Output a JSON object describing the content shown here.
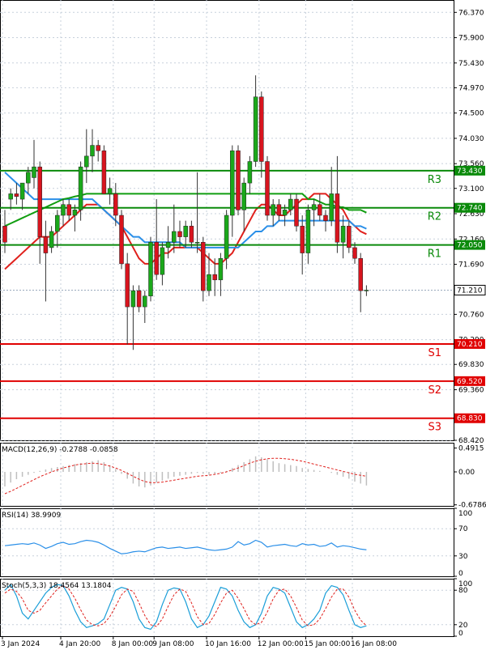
{
  "chart_data": [
    {
      "type": "candlestick",
      "panel": "main",
      "title": "",
      "xlabel": "",
      "ylabel": "",
      "ylim": [
        68.42,
        76.6
      ],
      "y_ticks": [
        "76.370",
        "75.900",
        "75.430",
        "74.970",
        "74.500",
        "74.030",
        "73.560",
        "73.100",
        "72.630",
        "72.160",
        "71.690",
        "70.760",
        "70.290",
        "69.830",
        "69.360",
        "68.420"
      ],
      "x_tick_labels": [
        "3 Jan 2024",
        "4 Jan 20:00",
        "8 Jan 00:00",
        "9 Jan 08:00",
        "10 Jan 16:00",
        "12 Jan 00:00",
        "15 Jan 00:00",
        "16 Jan 08:00"
      ],
      "candles": [
        {
          "o": 72.4,
          "h": 72.7,
          "l": 71.9,
          "c": 72.1
        },
        {
          "o": 72.9,
          "h": 73.1,
          "l": 72.7,
          "c": 73.0
        },
        {
          "o": 73.0,
          "h": 73.2,
          "l": 72.8,
          "c": 72.95
        },
        {
          "o": 72.9,
          "h": 73.2,
          "l": 72.7,
          "c": 73.2
        },
        {
          "o": 73.2,
          "h": 73.5,
          "l": 73.0,
          "c": 73.4
        },
        {
          "o": 73.3,
          "h": 74.0,
          "l": 73.1,
          "c": 73.5
        },
        {
          "o": 73.5,
          "h": 73.6,
          "l": 71.7,
          "c": 72.2
        },
        {
          "o": 72.2,
          "h": 72.5,
          "l": 71.0,
          "c": 71.9
        },
        {
          "o": 72.0,
          "h": 72.4,
          "l": 71.9,
          "c": 72.3
        },
        {
          "o": 72.3,
          "h": 72.7,
          "l": 72.0,
          "c": 72.6
        },
        {
          "o": 72.6,
          "h": 72.9,
          "l": 72.4,
          "c": 72.8
        },
        {
          "o": 72.8,
          "h": 72.9,
          "l": 72.5,
          "c": 72.6
        },
        {
          "o": 72.6,
          "h": 72.8,
          "l": 72.3,
          "c": 72.7
        },
        {
          "o": 72.7,
          "h": 73.6,
          "l": 72.5,
          "c": 73.5
        },
        {
          "o": 73.5,
          "h": 74.2,
          "l": 73.2,
          "c": 73.7
        },
        {
          "o": 73.7,
          "h": 74.2,
          "l": 73.4,
          "c": 73.9
        },
        {
          "o": 73.9,
          "h": 74.0,
          "l": 73.6,
          "c": 73.8
        },
        {
          "o": 73.8,
          "h": 73.9,
          "l": 73.0,
          "c": 73.0
        },
        {
          "o": 73.0,
          "h": 73.3,
          "l": 72.8,
          "c": 73.1
        },
        {
          "o": 73.0,
          "h": 73.2,
          "l": 72.4,
          "c": 72.6
        },
        {
          "o": 72.6,
          "h": 72.7,
          "l": 71.6,
          "c": 71.7
        },
        {
          "o": 71.7,
          "h": 71.9,
          "l": 70.2,
          "c": 70.9
        },
        {
          "o": 70.9,
          "h": 71.3,
          "l": 70.1,
          "c": 71.2
        },
        {
          "o": 71.2,
          "h": 71.3,
          "l": 70.8,
          "c": 70.9
        },
        {
          "o": 70.9,
          "h": 71.2,
          "l": 70.6,
          "c": 71.1
        },
        {
          "o": 71.1,
          "h": 72.2,
          "l": 71.0,
          "c": 72.1
        },
        {
          "o": 72.1,
          "h": 72.9,
          "l": 71.4,
          "c": 71.5
        },
        {
          "o": 71.5,
          "h": 72.1,
          "l": 71.3,
          "c": 72.0
        },
        {
          "o": 72.0,
          "h": 72.4,
          "l": 71.8,
          "c": 72.1
        },
        {
          "o": 72.1,
          "h": 72.8,
          "l": 71.9,
          "c": 72.3
        },
        {
          "o": 72.3,
          "h": 72.5,
          "l": 72.0,
          "c": 72.2
        },
        {
          "o": 72.2,
          "h": 72.5,
          "l": 72.0,
          "c": 72.4
        },
        {
          "o": 72.4,
          "h": 72.5,
          "l": 72.0,
          "c": 72.1
        },
        {
          "o": 72.1,
          "h": 73.4,
          "l": 71.9,
          "c": 72.1
        },
        {
          "o": 72.1,
          "h": 72.2,
          "l": 71.0,
          "c": 71.2
        },
        {
          "o": 71.2,
          "h": 71.9,
          "l": 71.1,
          "c": 71.5
        },
        {
          "o": 71.5,
          "h": 71.8,
          "l": 71.1,
          "c": 71.4
        },
        {
          "o": 71.4,
          "h": 71.9,
          "l": 71.1,
          "c": 71.8
        },
        {
          "o": 71.8,
          "h": 72.7,
          "l": 71.6,
          "c": 72.6
        },
        {
          "o": 72.6,
          "h": 73.9,
          "l": 72.2,
          "c": 73.8
        },
        {
          "o": 73.8,
          "h": 73.9,
          "l": 72.6,
          "c": 72.7
        },
        {
          "o": 72.7,
          "h": 73.3,
          "l": 72.3,
          "c": 73.2
        },
        {
          "o": 73.2,
          "h": 73.7,
          "l": 73.0,
          "c": 73.6
        },
        {
          "o": 73.6,
          "h": 75.2,
          "l": 73.5,
          "c": 74.8
        },
        {
          "o": 74.8,
          "h": 74.9,
          "l": 73.3,
          "c": 73.6
        },
        {
          "o": 73.6,
          "h": 73.7,
          "l": 72.5,
          "c": 72.6
        },
        {
          "o": 72.6,
          "h": 72.9,
          "l": 72.4,
          "c": 72.8
        },
        {
          "o": 72.8,
          "h": 72.9,
          "l": 72.5,
          "c": 72.6
        },
        {
          "o": 72.6,
          "h": 72.8,
          "l": 72.4,
          "c": 72.7
        },
        {
          "o": 72.7,
          "h": 73.0,
          "l": 72.6,
          "c": 72.9
        },
        {
          "o": 72.9,
          "h": 73.0,
          "l": 72.3,
          "c": 72.4
        },
        {
          "o": 72.4,
          "h": 72.6,
          "l": 71.5,
          "c": 71.9
        },
        {
          "o": 71.9,
          "h": 72.8,
          "l": 71.7,
          "c": 72.7
        },
        {
          "o": 72.7,
          "h": 72.9,
          "l": 72.4,
          "c": 72.8
        },
        {
          "o": 72.8,
          "h": 73.0,
          "l": 72.5,
          "c": 72.6
        },
        {
          "o": 72.6,
          "h": 72.7,
          "l": 72.3,
          "c": 72.5
        },
        {
          "o": 72.5,
          "h": 73.5,
          "l": 72.4,
          "c": 73.0
        },
        {
          "o": 73.0,
          "h": 73.7,
          "l": 71.9,
          "c": 72.1
        },
        {
          "o": 72.1,
          "h": 72.6,
          "l": 71.8,
          "c": 72.4
        },
        {
          "o": 72.4,
          "h": 72.5,
          "l": 71.9,
          "c": 72.0
        },
        {
          "o": 72.0,
          "h": 72.1,
          "l": 71.7,
          "c": 71.8
        },
        {
          "o": 71.8,
          "h": 71.9,
          "l": 70.8,
          "c": 71.2
        },
        {
          "o": 71.2,
          "h": 71.3,
          "l": 71.1,
          "c": 71.21
        }
      ],
      "series": [
        {
          "name": "",
          "color": "#e0201c",
          "values": [
            71.6,
            71.7,
            71.8,
            71.9,
            72.0,
            72.1,
            72.2,
            72.2,
            72.2,
            72.3,
            72.4,
            72.5,
            72.6,
            72.7,
            72.8,
            72.8,
            72.8,
            72.7,
            72.6,
            72.5,
            72.4,
            72.2,
            72.0,
            71.8,
            71.7,
            71.7,
            71.8,
            71.9,
            71.9,
            72.0,
            72.0,
            72.0,
            72.0,
            72.0,
            71.9,
            71.8,
            71.7,
            71.7,
            71.8,
            71.9,
            72.1,
            72.3,
            72.5,
            72.7,
            72.8,
            72.8,
            72.7,
            72.6,
            72.6,
            72.7,
            72.8,
            72.9,
            72.9,
            73.0,
            73.0,
            73.0,
            72.9,
            72.8,
            72.7,
            72.5,
            72.4,
            72.3,
            72.25
          ]
        },
        {
          "name": "",
          "color": "#2a8fe8",
          "values": [
            73.4,
            73.3,
            73.2,
            73.1,
            73.0,
            72.9,
            72.9,
            72.9,
            72.9,
            72.9,
            72.9,
            72.9,
            72.9,
            72.9,
            72.9,
            72.9,
            72.8,
            72.7,
            72.6,
            72.5,
            72.4,
            72.3,
            72.2,
            72.2,
            72.1,
            72.1,
            72.1,
            72.1,
            72.1,
            72.1,
            72.1,
            72.0,
            72.0,
            72.0,
            72.0,
            72.0,
            72.0,
            72.0,
            72.0,
            72.0,
            72.0,
            72.1,
            72.2,
            72.3,
            72.3,
            72.4,
            72.4,
            72.5,
            72.5,
            72.5,
            72.5,
            72.5,
            72.5,
            72.5,
            72.5,
            72.5,
            72.5,
            72.5,
            72.5,
            72.5,
            72.4,
            72.4,
            72.35
          ]
        },
        {
          "name": "",
          "color": "#119e11",
          "values": [
            72.4,
            72.45,
            72.5,
            72.55,
            72.6,
            72.65,
            72.7,
            72.75,
            72.8,
            72.85,
            72.9,
            72.92,
            72.95,
            72.97,
            73.0,
            73.0,
            73.0,
            73.0,
            73.0,
            73.0,
            73.0,
            73.0,
            73.0,
            73.0,
            73.0,
            73.0,
            73.0,
            73.0,
            73.0,
            73.0,
            73.0,
            73.0,
            73.0,
            73.0,
            73.0,
            73.0,
            73.0,
            73.0,
            73.0,
            73.0,
            73.0,
            73.0,
            73.0,
            73.0,
            73.0,
            73.0,
            73.0,
            73.0,
            73.0,
            73.0,
            73.0,
            73.0,
            72.9,
            72.9,
            72.85,
            72.8,
            72.8,
            72.75,
            72.75,
            72.7,
            72.7,
            72.7,
            72.65
          ]
        }
      ],
      "levels": [
        {
          "name": "R3",
          "value": 73.43,
          "label": "73.430",
          "color": "#0a8a0a"
        },
        {
          "name": "R2",
          "value": 72.74,
          "label": "72.740",
          "color": "#0a8a0a"
        },
        {
          "name": "R1",
          "value": 72.05,
          "label": "72.050",
          "color": "#0a8a0a"
        },
        {
          "name": "S1",
          "value": 70.21,
          "label": "70.210",
          "color": "#e00000"
        },
        {
          "name": "S2",
          "value": 69.52,
          "label": "69.520",
          "color": "#e00000"
        },
        {
          "name": "S3",
          "value": 68.83,
          "label": "68.830",
          "color": "#e00000"
        }
      ],
      "current_price": {
        "value": 71.21,
        "label": "71.210"
      },
      "grid": true
    },
    {
      "type": "bar",
      "panel": "macd",
      "title": "MACD(12,26,9) -0.2788 -0.0858",
      "ylim": [
        -0.7,
        0.6
      ],
      "y_ticks": [
        "0.4915",
        "0.00",
        "-0.6786"
      ],
      "values": [
        -0.3,
        -0.22,
        -0.15,
        -0.1,
        -0.06,
        -0.02,
        0.02,
        0.05,
        0.08,
        0.1,
        0.12,
        0.14,
        0.16,
        0.18,
        0.2,
        0.22,
        0.24,
        0.2,
        0.14,
        0.06,
        -0.04,
        -0.14,
        -0.24,
        -0.3,
        -0.32,
        -0.28,
        -0.22,
        -0.18,
        -0.14,
        -0.1,
        -0.08,
        -0.06,
        -0.04,
        -0.02,
        -0.04,
        -0.06,
        -0.04,
        -0.02,
        0.02,
        0.08,
        0.14,
        0.2,
        0.26,
        0.32,
        0.3,
        0.26,
        0.22,
        0.18,
        0.16,
        0.14,
        0.12,
        0.08,
        0.06,
        0.04,
        0.02,
        0.0,
        -0.02,
        -0.06,
        -0.1,
        -0.14,
        -0.2,
        -0.24,
        -0.28
      ],
      "signal": [
        -0.45,
        -0.4,
        -0.34,
        -0.28,
        -0.22,
        -0.16,
        -0.1,
        -0.05,
        0.0,
        0.04,
        0.08,
        0.11,
        0.14,
        0.16,
        0.17,
        0.18,
        0.17,
        0.15,
        0.12,
        0.08,
        0.03,
        -0.03,
        -0.09,
        -0.15,
        -0.2,
        -0.22,
        -0.22,
        -0.21,
        -0.19,
        -0.17,
        -0.15,
        -0.13,
        -0.11,
        -0.09,
        -0.08,
        -0.07,
        -0.05,
        -0.03,
        0.0,
        0.04,
        0.08,
        0.13,
        0.18,
        0.22,
        0.25,
        0.27,
        0.28,
        0.28,
        0.27,
        0.26,
        0.24,
        0.22,
        0.19,
        0.16,
        0.13,
        0.1,
        0.07,
        0.04,
        0.01,
        -0.02,
        -0.05,
        -0.07,
        -0.09
      ]
    },
    {
      "type": "line",
      "panel": "rsi",
      "title": "RSI(14) 38.9909",
      "ylim": [
        0,
        100
      ],
      "y_ticks": [
        "100",
        "70",
        "30",
        "0"
      ],
      "values": [
        45,
        46,
        47,
        48,
        47,
        49,
        46,
        41,
        44,
        48,
        50,
        47,
        48,
        51,
        53,
        52,
        50,
        46,
        41,
        37,
        33,
        34,
        36,
        37,
        36,
        39,
        42,
        43,
        41,
        42,
        43,
        41,
        42,
        43,
        41,
        39,
        38,
        39,
        40,
        43,
        51,
        46,
        48,
        53,
        50,
        43,
        45,
        46,
        47,
        45,
        44,
        48,
        46,
        47,
        44,
        45,
        49,
        43,
        45,
        44,
        42,
        40,
        39
      ]
    },
    {
      "type": "line",
      "panel": "stoch",
      "title": "Stoch(5,3,3) 18.4564 13.1804",
      "ylim": [
        0,
        100
      ],
      "y_ticks": [
        "100",
        "80",
        "20",
        "0"
      ],
      "k": [
        80,
        90,
        70,
        40,
        30,
        45,
        60,
        75,
        85,
        90,
        88,
        70,
        45,
        25,
        15,
        18,
        22,
        30,
        55,
        80,
        85,
        82,
        60,
        30,
        15,
        12,
        25,
        55,
        80,
        84,
        82,
        60,
        30,
        15,
        20,
        35,
        60,
        85,
        82,
        70,
        45,
        25,
        15,
        20,
        40,
        70,
        85,
        82,
        75,
        50,
        25,
        15,
        20,
        30,
        45,
        75,
        88,
        85,
        72,
        45,
        20,
        15,
        18
      ],
      "d": [
        75,
        82,
        78,
        65,
        45,
        40,
        45,
        58,
        70,
        82,
        88,
        82,
        66,
        46,
        28,
        20,
        18,
        22,
        34,
        52,
        72,
        82,
        78,
        58,
        36,
        20,
        17,
        30,
        52,
        72,
        82,
        78,
        58,
        34,
        20,
        22,
        38,
        58,
        75,
        80,
        66,
        48,
        28,
        20,
        24,
        42,
        65,
        80,
        82,
        70,
        50,
        28,
        18,
        20,
        30,
        48,
        68,
        82,
        82,
        68,
        45,
        28,
        18
      ]
    }
  ]
}
